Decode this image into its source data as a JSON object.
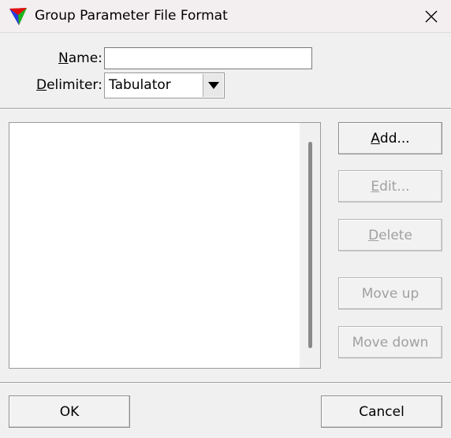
{
  "window": {
    "title": "Group Parameter File Format",
    "close_icon": "close-icon"
  },
  "form": {
    "name_label_mnemonic": "N",
    "name_label_rest": "ame:",
    "name_value": "",
    "delimiter_label_mnemonic": "D",
    "delimiter_label_rest": "elimiter:",
    "delimiter_value": "Tabulator"
  },
  "list": {
    "items": []
  },
  "buttons": {
    "add_mnemonic": "A",
    "add_rest": "dd...",
    "edit_mnemonic": "E",
    "edit_rest": "dit...",
    "delete_mnemonic": "D",
    "delete_rest": "elete",
    "move_up": "Move up",
    "move_down": "Move down",
    "ok": "OK",
    "cancel": "Cancel"
  }
}
